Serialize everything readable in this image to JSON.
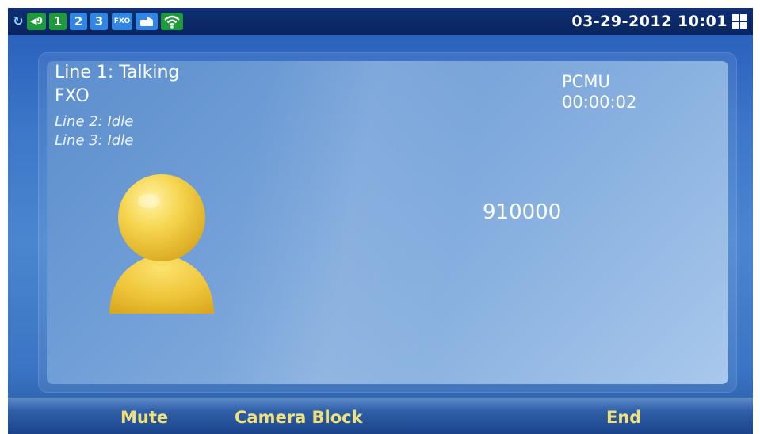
{
  "status_bar": {
    "sync_icon": "sync-icon",
    "volume_label": "◀9",
    "lines": [
      "1",
      "2",
      "3"
    ],
    "fxo_label": "FXO",
    "datetime": "03-29-2012 10:01",
    "colors": {
      "active": "#1f9a3a",
      "inactive": "#2f86e4",
      "bar": "#0d2f73"
    }
  },
  "call": {
    "line1_status": "Line 1: Talking",
    "line1_type": "FXO",
    "line2_status": "Line 2: Idle",
    "line3_status": "Line 3: Idle",
    "codec": "PCMU",
    "duration": "00:00:02",
    "number": "910000"
  },
  "softkeys": {
    "mute": "Mute",
    "camera_block": "Camera Block",
    "end": "End",
    "color": "#f0e07a"
  }
}
